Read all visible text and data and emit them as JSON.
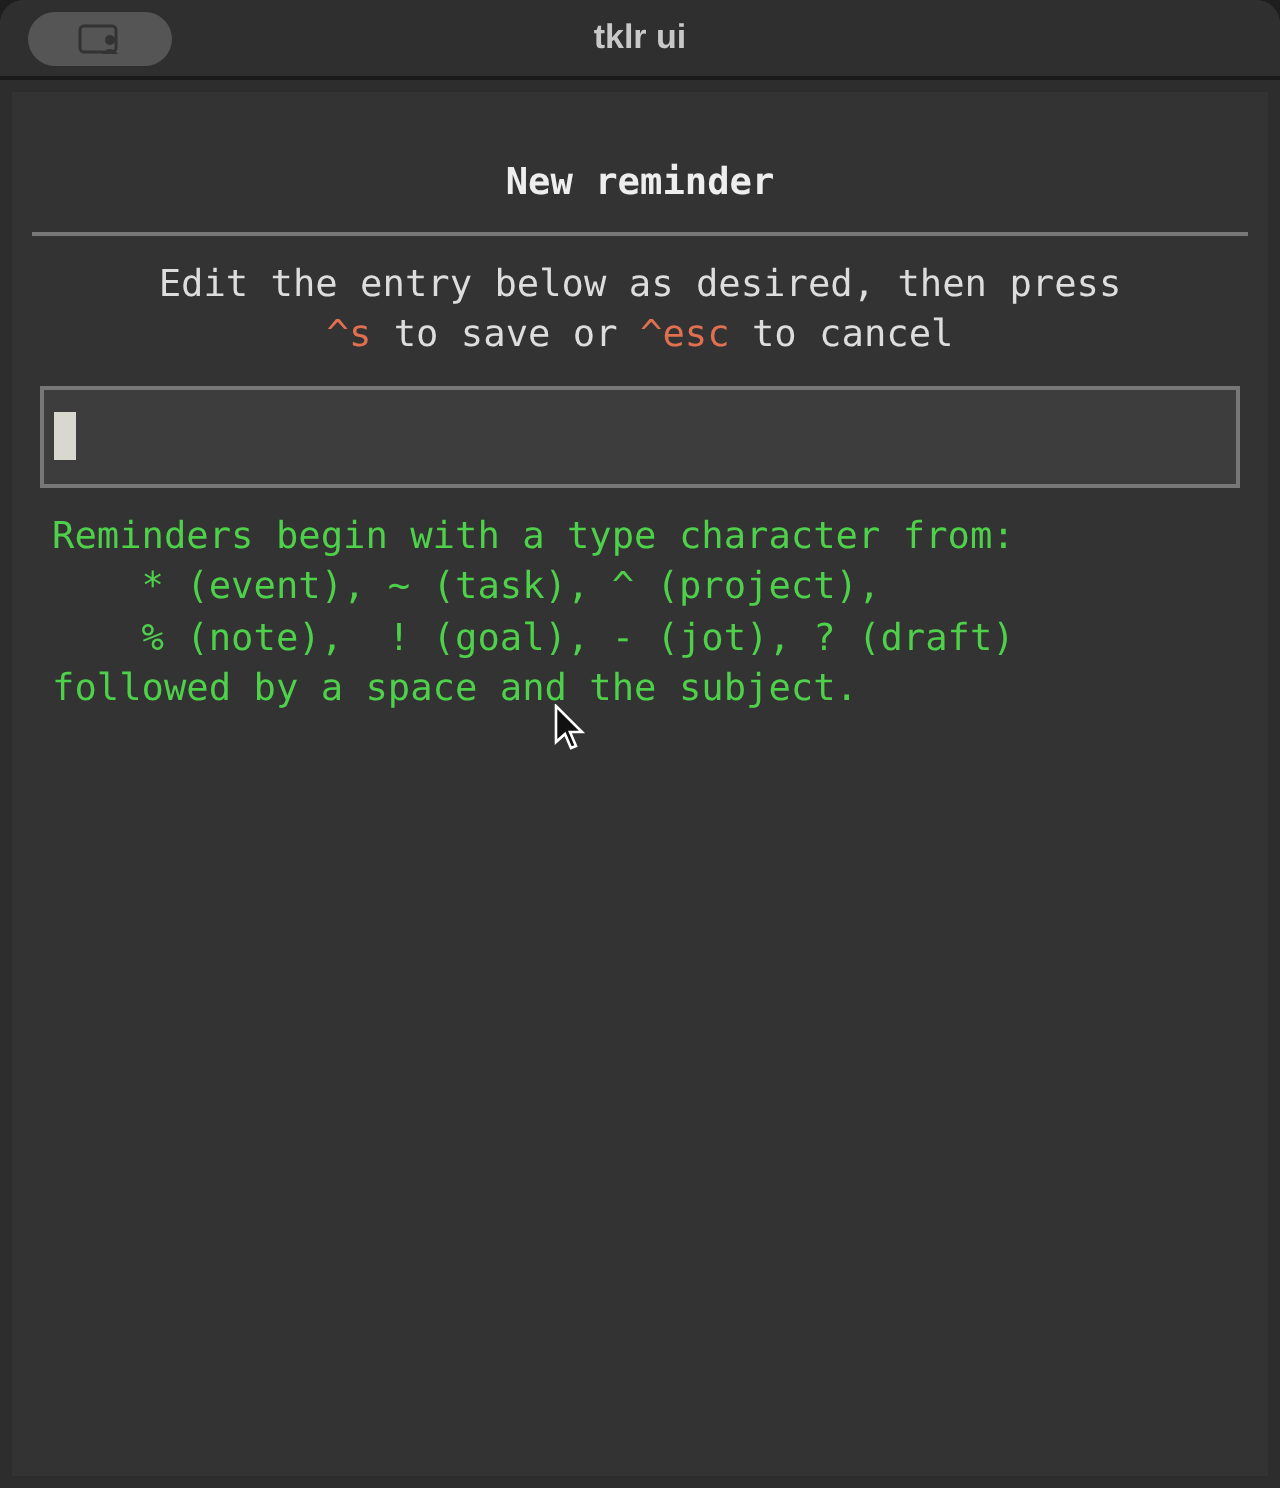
{
  "window": {
    "title": "tklr ui"
  },
  "dialog": {
    "title": "New reminder",
    "instructions": [
      [
        {
          "kind": "text",
          "text": "Edit the entry below as desired, then press"
        }
      ],
      [
        {
          "kind": "key",
          "text": "^s"
        },
        {
          "kind": "text",
          "text": " to save or "
        },
        {
          "kind": "key",
          "text": "^esc"
        },
        {
          "kind": "text",
          "text": " to cancel"
        }
      ]
    ],
    "help": [
      "Reminders begin with a type character from:",
      "    * (event), ~ (task), ^ (project),",
      "    % (note),  ! (goal), - (jot), ? (draft)",
      "followed by a space and the subject."
    ]
  }
}
